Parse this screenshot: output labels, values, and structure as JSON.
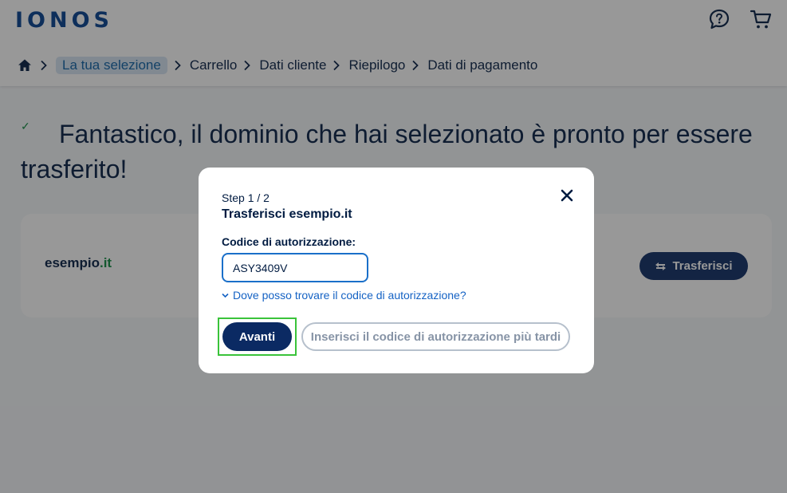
{
  "header": {
    "logo_text": "IONOS",
    "help_icon": "help-chat-icon",
    "cart_icon": "cart-icon"
  },
  "breadcrumb": {
    "home_icon": "home-icon",
    "items": [
      "La tua selezione",
      "Carrello",
      "Dati cliente",
      "Riepilogo",
      "Dati di pagamento"
    ]
  },
  "main": {
    "check_glyph": "✓",
    "title": "Fantastico, il dominio che hai selezionato è pronto per essere trasferito!",
    "card": {
      "domain_name": "esempio",
      "domain_tld": ".it",
      "transfer_button": "Trasferisci"
    }
  },
  "modal": {
    "step": "Step 1 / 2",
    "title": "Trasferisci esempio.it",
    "field_label": "Codice di autorizzazione:",
    "field_value": "ASY3409V",
    "help_link": "Dove posso trovare il codice di autorizzazione?",
    "next_button": "Avanti",
    "later_button": "Inserisci il codice di autorizzazione più tardi"
  },
  "colors": {
    "brand": "#003d8f",
    "primary_button": "#0b2a63",
    "link": "#1462c4",
    "success": "#0c8a3d",
    "highlight_outline": "#3ac33a"
  }
}
